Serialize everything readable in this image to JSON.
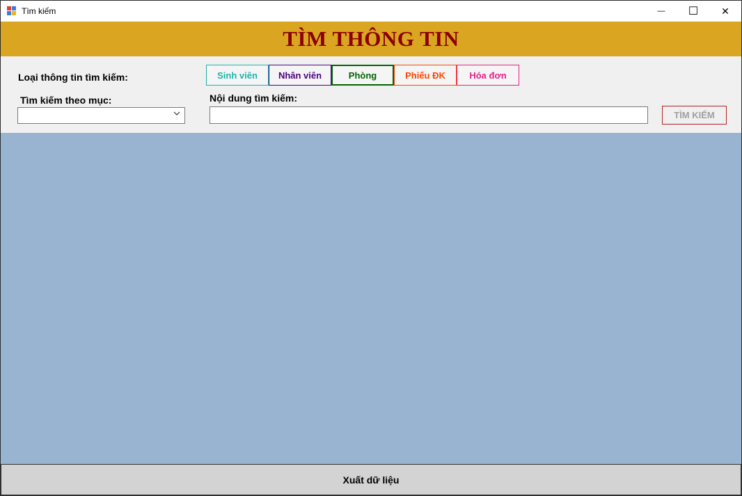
{
  "window": {
    "title": "Tìm kiếm",
    "minimize_glyph": "—",
    "maximize_glyph": "☐",
    "close_glyph": "✕"
  },
  "banner": {
    "title": "TÌM THÔNG TIN",
    "background": "#daa520",
    "color": "#8b0000"
  },
  "form": {
    "type_label": "Loại thông tin tìm kiếm:",
    "category_label": "Tìm kiếm theo mục:",
    "content_label": "Nội dung tìm kiếm:",
    "category_value": "",
    "search_value": "",
    "search_button": "TÌM KIẾM",
    "chevron_icon": "chevron-down-icon"
  },
  "type_buttons": [
    {
      "label": "Sinh viên",
      "color": "#20b2aa",
      "border": "#20b2aa"
    },
    {
      "label": "Nhân viên",
      "color": "#4b0082",
      "border": "#4b0082"
    },
    {
      "label": "Phòng",
      "color": "#006400",
      "border": "#006400"
    },
    {
      "label": "Phiếu ĐK",
      "color": "#ff4500",
      "border": "#ff4500"
    },
    {
      "label": "Hóa đơn",
      "color": "#e81f8a",
      "border": "#e81f8a"
    }
  ],
  "results": {
    "background": "#99b4d1"
  },
  "export": {
    "label": "Xuất dữ liệu"
  }
}
